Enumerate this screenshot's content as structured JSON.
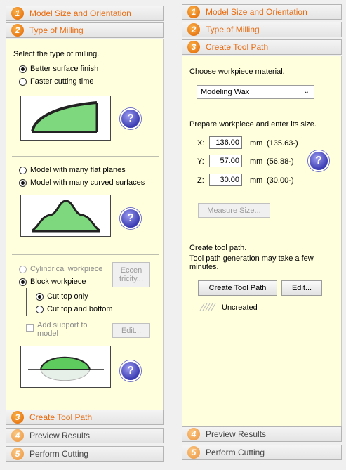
{
  "left": {
    "steps": [
      {
        "num": "1",
        "label": "Model Size and Orientation"
      },
      {
        "num": "2",
        "label": "Type of Milling"
      },
      {
        "num": "3",
        "label": "Create Tool Path"
      },
      {
        "num": "4",
        "label": "Preview Results"
      },
      {
        "num": "5",
        "label": "Perform Cutting"
      }
    ],
    "milling_prompt": "Select the type of milling.",
    "finish_options": [
      "Better surface finish",
      "Faster cutting time"
    ],
    "surface_options": [
      "Model with many flat planes",
      "Model with many curved surfaces"
    ],
    "workpiece_options": [
      "Cylindrical workpiece",
      "Block workpiece"
    ],
    "eccentricity_button": "Eccen\ntricity...",
    "cut_options": [
      "Cut top only",
      "Cut top and bottom"
    ],
    "support_label": "Add support to model",
    "edit_button": "Edit...",
    "help_glyph": "?"
  },
  "right": {
    "steps": [
      {
        "num": "1",
        "label": "Model Size and Orientation"
      },
      {
        "num": "2",
        "label": "Type of Milling"
      },
      {
        "num": "3",
        "label": "Create Tool Path"
      },
      {
        "num": "4",
        "label": "Preview Results"
      },
      {
        "num": "5",
        "label": "Perform Cutting"
      }
    ],
    "material_prompt": "Choose workpiece material.",
    "material_value": "Modeling Wax",
    "size_prompt": "Prepare workpiece and enter its size.",
    "dims": [
      {
        "axis": "X:",
        "value": "136.00",
        "unit": "mm",
        "model": "(135.63-)"
      },
      {
        "axis": "Y:",
        "value": "57.00",
        "unit": "mm",
        "model": "(56.88-)"
      },
      {
        "axis": "Z:",
        "value": "30.00",
        "unit": "mm",
        "model": "(30.00-)"
      }
    ],
    "measure_button": "Measure Size...",
    "toolpath_prompt_1": "Create tool path.",
    "toolpath_prompt_2": "Tool path generation may take a few minutes.",
    "create_button": "Create Tool Path",
    "edit_button": "Edit...",
    "status": "Uncreated",
    "help_glyph": "?"
  }
}
